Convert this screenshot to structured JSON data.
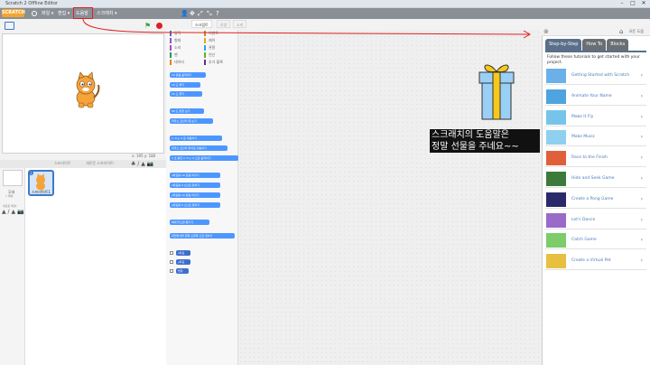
{
  "window": {
    "title": "Scratch 2 Offline Editor",
    "btn_min": "–",
    "btn_max": "□",
    "btn_close": "✕"
  },
  "menubar": {
    "logo": "SCRATCH",
    "items": [
      "파일 ▾",
      "편집 ▾",
      "도움말",
      "스크래치 ▾"
    ],
    "tools": [
      "👤",
      "✥",
      "⤢",
      "⤡",
      "?"
    ]
  },
  "stage_tabs": [
    "스크립트",
    "모양",
    "소리"
  ],
  "categories": [
    {
      "name": "동작",
      "color": "#4a6cd4"
    },
    {
      "name": "형태",
      "color": "#8a55d7"
    },
    {
      "name": "소리",
      "color": "#bb42c3"
    },
    {
      "name": "펜",
      "color": "#0e9a6c"
    },
    {
      "name": "데이터",
      "color": "#ee7d16"
    },
    {
      "name": "이벤트",
      "color": "#c88330"
    },
    {
      "name": "제어",
      "color": "#e1a91a"
    },
    {
      "name": "관찰",
      "color": "#2ca5e2"
    },
    {
      "name": "연산",
      "color": "#5cb712"
    },
    {
      "name": "추가 블록",
      "color": "#632d99"
    }
  ],
  "blocks": [
    "10 만큼 움직이기",
    "15 도 돌기",
    "15 도 돌기",
    "90 도 방향 보기",
    "마우스 포인터 쪽 보기",
    "x: 0 y: 0 로 이동하기",
    "마우스 포인터 위치로 이동하기",
    "1 초 동안 x: 0 y: 0 으로 움직이기",
    "x좌표를 10 만큼 바꾸기",
    "x좌표를 0 (으)로 정하기",
    "y좌표를 10 만큼 바꾸기",
    "y좌표를 0 (으)로 정하기",
    "벽에 닿으면 튕기기",
    "회전방식을 왼쪽-오른쪽 으로 정하기",
    "x좌표",
    "y좌표",
    "방향"
  ],
  "stage": {
    "xy": "x: 195  y: 180"
  },
  "sprites": {
    "label": "스프라이트",
    "new_sprite": "새로운 스프라이트:",
    "tools": "♣ / ▲ 📷",
    "stage_label": "무대",
    "stage_sub": "1 배경",
    "new_backdrop": "새로운 배경:",
    "backdrop_tools": "▲ / ▲ 📷",
    "sprite_name": "스프라이트1",
    "info": "i"
  },
  "help": {
    "close": "⊗",
    "home": "⌂",
    "all": "모든 도움",
    "tabs": [
      "Step-by-Step",
      "How To",
      "Blocks"
    ],
    "intro": "Follow these tutorials to get started with your project.",
    "tutorials": [
      {
        "label": "Getting Started with Scratch",
        "color": "#6cb0e8"
      },
      {
        "label": "Animate Your Name",
        "color": "#4fa3df"
      },
      {
        "label": "Make It Fly",
        "color": "#77c4ea"
      },
      {
        "label": "Make Music",
        "color": "#8fd0f0"
      },
      {
        "label": "Race to the Finish",
        "color": "#e0603a"
      },
      {
        "label": "Hide and Seek Game",
        "color": "#3c7a3c"
      },
      {
        "label": "Create a Pong Game",
        "color": "#2a2a6a"
      },
      {
        "label": "Let's Dance",
        "color": "#9a6ac8"
      },
      {
        "label": "Catch Game",
        "color": "#7ccc6a"
      },
      {
        "label": "Create a Virtual Pet",
        "color": "#e8c040"
      }
    ],
    "arrow": "›"
  },
  "caption": "스크래치의 도움말은\n정말 선물을 주네요~~",
  "colors": {
    "accent": "#4c97ff",
    "annotation": "#e02020"
  }
}
